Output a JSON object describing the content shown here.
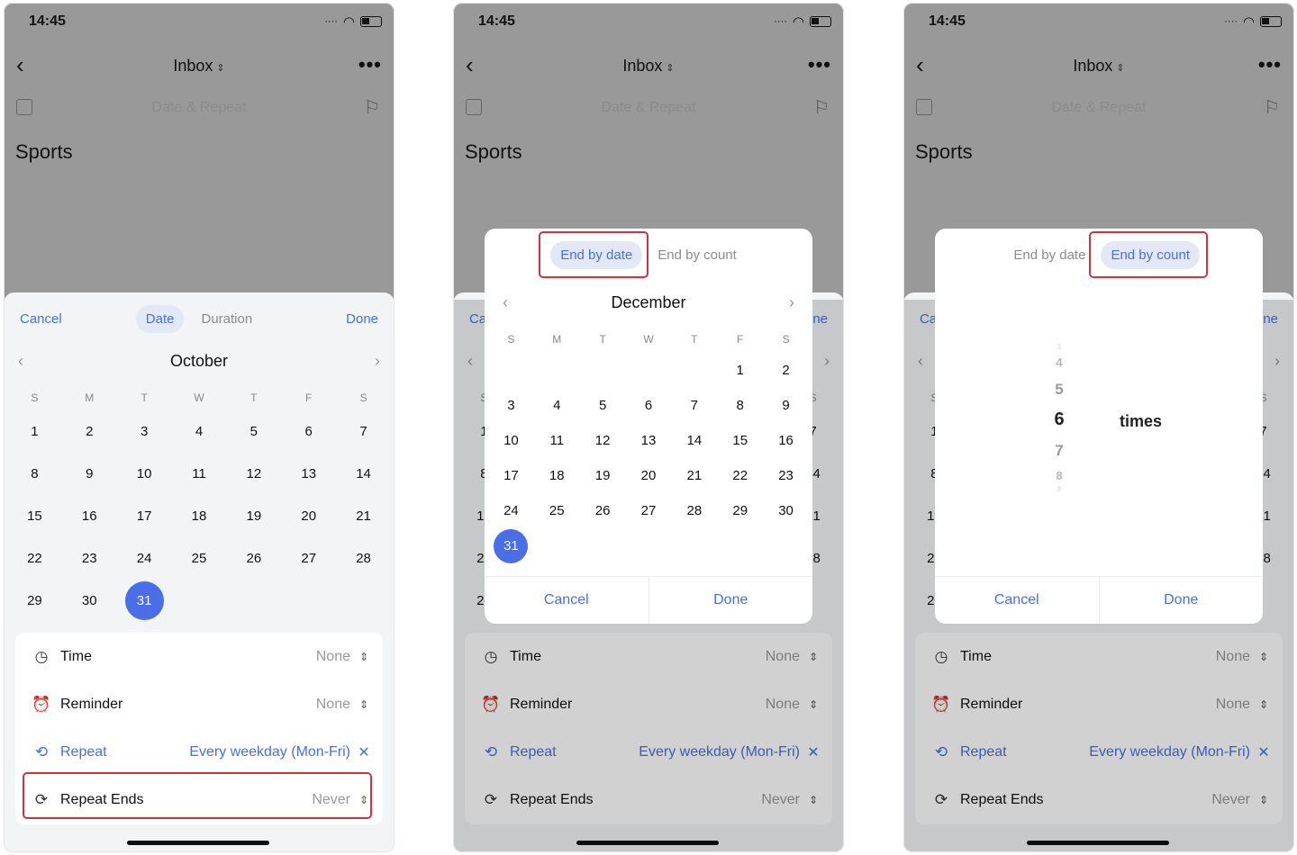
{
  "status": {
    "time": "14:45"
  },
  "nav": {
    "title": "Inbox",
    "title_chevron": "⇕",
    "back": "‹",
    "more": "•••"
  },
  "task": {
    "placeholder": "Date & Repeat",
    "title": "Sports"
  },
  "sheet": {
    "cancel": "Cancel",
    "done": "Done",
    "tab_date": "Date",
    "tab_duration": "Duration"
  },
  "calendar": {
    "month": "October",
    "weekdays": [
      "S",
      "M",
      "T",
      "W",
      "T",
      "F",
      "S"
    ],
    "weeks": [
      [
        "1",
        "2",
        "3",
        "4",
        "5",
        "6",
        "7"
      ],
      [
        "8",
        "9",
        "10",
        "11",
        "12",
        "13",
        "14"
      ],
      [
        "15",
        "16",
        "17",
        "18",
        "19",
        "20",
        "21"
      ],
      [
        "22",
        "23",
        "24",
        "25",
        "26",
        "27",
        "28"
      ],
      [
        "29",
        "30",
        "31",
        "",
        "",
        "",
        ""
      ]
    ],
    "selected": "31"
  },
  "options": {
    "time": {
      "label": "Time",
      "value": "None"
    },
    "reminder": {
      "label": "Reminder",
      "value": "None"
    },
    "repeat": {
      "label": "Repeat",
      "value": "Every weekday (Mon-Fri)",
      "clear": "✕"
    },
    "repeat_ends": {
      "label": "Repeat Ends",
      "value": "Never"
    }
  },
  "modal_date": {
    "tab_date": "End by date",
    "tab_count": "End by count",
    "month": "December",
    "weekdays": [
      "S",
      "M",
      "T",
      "W",
      "T",
      "F",
      "S"
    ],
    "weeks": [
      [
        "",
        "",
        "",
        "",
        "",
        "1",
        "2"
      ],
      [
        "3",
        "4",
        "5",
        "6",
        "7",
        "8",
        "9"
      ],
      [
        "10",
        "11",
        "12",
        "13",
        "14",
        "15",
        "16"
      ],
      [
        "17",
        "18",
        "19",
        "20",
        "21",
        "22",
        "23"
      ],
      [
        "24",
        "25",
        "26",
        "27",
        "28",
        "29",
        "30"
      ],
      [
        "31",
        "",
        "",
        "",
        "",
        "",
        ""
      ]
    ],
    "selected": "31",
    "cancel": "Cancel",
    "done": "Done"
  },
  "modal_count": {
    "tab_date": "End by date",
    "tab_count": "End by count",
    "wheel": [
      "3",
      "4",
      "5",
      "6",
      "7",
      "8",
      "9"
    ],
    "selected": "6",
    "unit": "times",
    "cancel": "Cancel",
    "done": "Done"
  },
  "colors": {
    "accent": "#4472e2",
    "selected_day": "#4a6ee8",
    "highlight_box": "#c9363e",
    "backdrop": "#999999"
  }
}
